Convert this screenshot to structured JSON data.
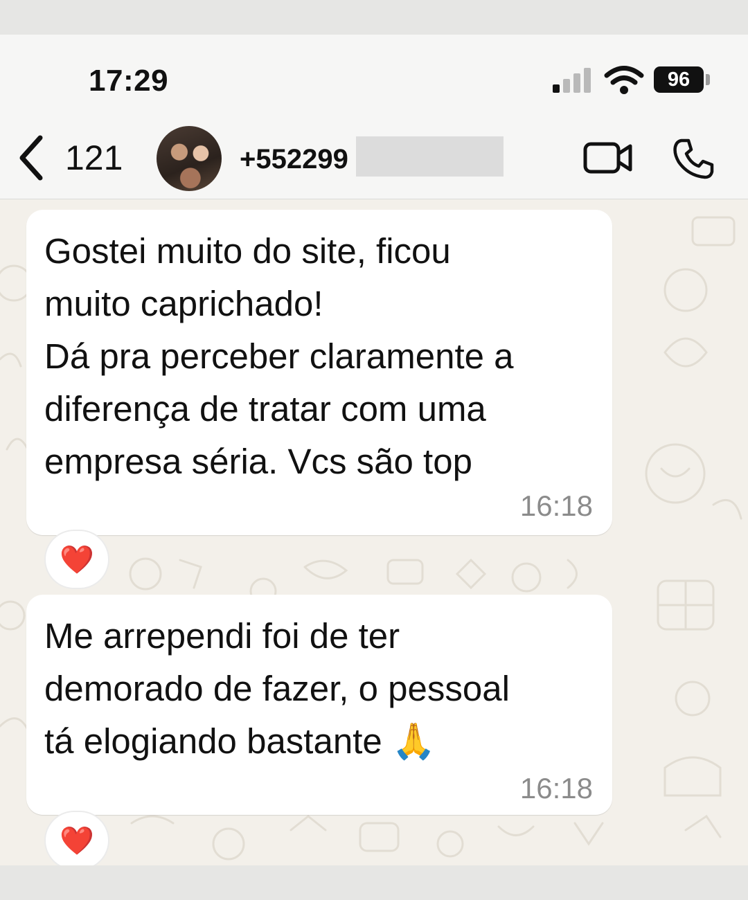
{
  "status_bar": {
    "time": "17:29",
    "battery": "96"
  },
  "header": {
    "back_count": "121",
    "contact": "+552299"
  },
  "messages": [
    {
      "text": "Gostei muito do site, ficou\nmuito caprichado!\nDá pra perceber claramente a\ndiferença de tratar com uma\nempresa séria. Vcs são top",
      "time": "16:18",
      "reaction": "❤️"
    },
    {
      "text": "Me arrependi foi de ter\ndemorado de fazer, o pessoal\ntá elogiando bastante 🙏",
      "time": "16:18",
      "reaction": "❤️"
    }
  ],
  "colors": {
    "chat_background": "#f3f0ea",
    "bubble": "#ffffff",
    "timestamp": "#8b8b8b"
  },
  "icons": [
    "back-chevron-icon",
    "video-camera-icon",
    "phone-icon",
    "signal-icon",
    "wifi-icon",
    "battery-icon"
  ]
}
